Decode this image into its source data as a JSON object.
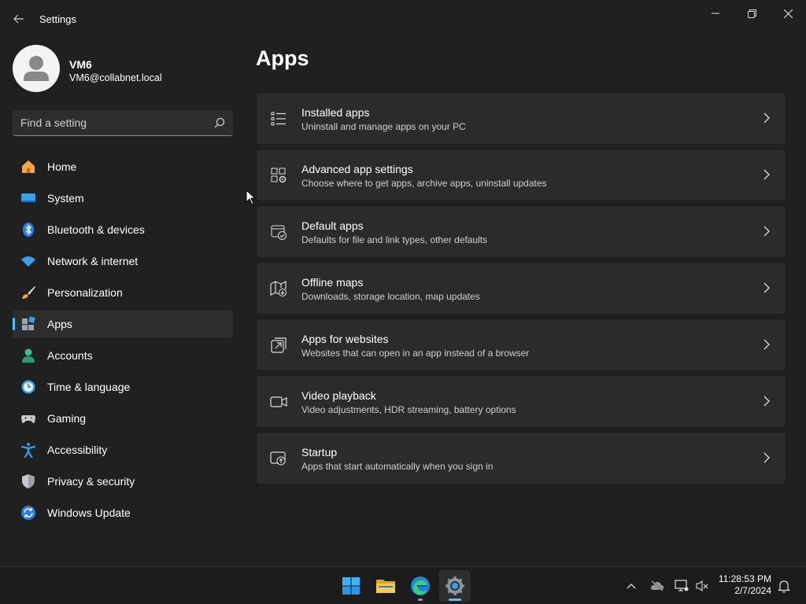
{
  "window": {
    "title": "Settings"
  },
  "profile": {
    "name": "VM6",
    "email": "VM6@collabnet.local"
  },
  "search": {
    "placeholder": "Find a setting",
    "value": ""
  },
  "sidebar": {
    "items": [
      {
        "label": "Home",
        "icon": "home-icon"
      },
      {
        "label": "System",
        "icon": "system-icon"
      },
      {
        "label": "Bluetooth & devices",
        "icon": "bluetooth-icon"
      },
      {
        "label": "Network & internet",
        "icon": "wifi-icon"
      },
      {
        "label": "Personalization",
        "icon": "brush-icon"
      },
      {
        "label": "Apps",
        "icon": "apps-icon",
        "selected": true
      },
      {
        "label": "Accounts",
        "icon": "accounts-icon"
      },
      {
        "label": "Time & language",
        "icon": "time-language-icon"
      },
      {
        "label": "Gaming",
        "icon": "gamepad-icon"
      },
      {
        "label": "Accessibility",
        "icon": "accessibility-icon"
      },
      {
        "label": "Privacy & security",
        "icon": "shield-icon"
      },
      {
        "label": "Windows Update",
        "icon": "update-icon"
      }
    ]
  },
  "main": {
    "title": "Apps",
    "cards": [
      {
        "title": "Installed apps",
        "desc": "Uninstall and manage apps on your PC",
        "icon": "list-icon"
      },
      {
        "title": "Advanced app settings",
        "desc": "Choose where to get apps, archive apps, uninstall updates",
        "icon": "app-settings-icon"
      },
      {
        "title": "Default apps",
        "desc": "Defaults for file and link types, other defaults",
        "icon": "default-apps-icon"
      },
      {
        "title": "Offline maps",
        "desc": "Downloads, storage location, map updates",
        "icon": "map-icon"
      },
      {
        "title": "Apps for websites",
        "desc": "Websites that can open in an app instead of a browser",
        "icon": "open-external-icon"
      },
      {
        "title": "Video playback",
        "desc": "Video adjustments, HDR streaming, battery options",
        "icon": "video-icon"
      },
      {
        "title": "Startup",
        "desc": "Apps that start automatically when you sign in",
        "icon": "startup-icon"
      }
    ]
  },
  "taskbar": {
    "time": "11:28:53 PM",
    "date": "2/7/2024",
    "apps": [
      "start-icon",
      "file-explorer-icon",
      "edge-icon",
      "settings-icon"
    ]
  },
  "colors": {
    "accent": "#4cc2ff",
    "background": "#202020",
    "card": "#2b2b2b"
  }
}
